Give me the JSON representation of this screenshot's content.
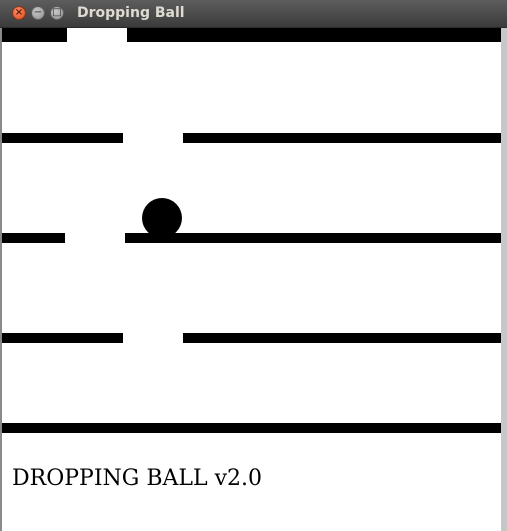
{
  "window": {
    "title": "Dropping Ball"
  },
  "icons": {
    "close": "close-icon",
    "minimize": "minimize-icon",
    "maximize": "maximize-icon"
  },
  "colors": {
    "background": "#ffffff",
    "foreground": "#000000",
    "titlebar": "#3c3b37",
    "close_button": "#dd4814"
  },
  "game": {
    "title": "DROPPING BALL v2.0"
  }
}
